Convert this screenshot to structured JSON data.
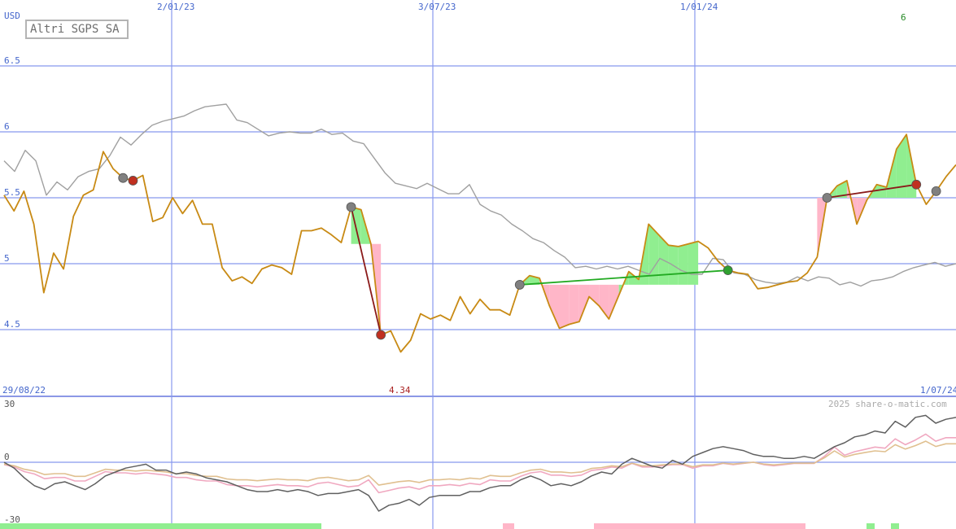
{
  "chart_data": [
    {
      "type": "line",
      "title": "Altri SGPS SA",
      "ylabel": "USD",
      "ylim": [
        4.0,
        7.0
      ],
      "yticks": [
        4.5,
        5,
        5.5,
        6,
        6.5
      ],
      "ytick_labels": [
        "4.5",
        "5",
        "5.5",
        "6",
        "6.5"
      ],
      "top_date_labels": [
        "2/01/23",
        "3/07/23",
        "1/01/24"
      ],
      "start_date": "29/08/22",
      "end_date": "1/07/24",
      "low_label": "4.34",
      "high_label": "6",
      "series": [
        {
          "values": [
            5.52,
            5.4,
            5.55,
            5.3,
            4.78,
            5.08,
            4.96,
            5.36,
            5.52,
            5.56,
            5.85,
            5.72,
            5.65,
            5.63,
            5.67,
            5.32,
            5.35,
            5.5,
            5.38,
            5.48,
            5.3,
            5.3,
            4.97,
            4.87,
            4.9,
            4.85,
            4.96,
            4.99,
            4.97,
            4.92,
            5.25,
            5.25,
            5.27,
            5.22,
            5.16,
            5.43,
            5.41,
            5.15,
            4.46,
            4.49,
            4.33,
            4.42,
            4.62,
            4.58,
            4.61,
            4.57,
            4.75,
            4.62,
            4.73,
            4.65,
            4.65,
            4.61,
            4.84,
            4.91,
            4.89,
            4.68,
            4.51,
            4.54,
            4.56,
            4.75,
            4.68,
            4.58,
            4.76,
            4.94,
            4.88,
            5.3,
            5.22,
            5.14,
            5.13,
            5.15,
            5.17,
            5.12,
            5.02,
            4.95,
            4.93,
            4.92,
            4.81,
            4.82,
            4.84,
            4.86,
            4.87,
            4.93,
            5.05,
            5.5,
            5.59,
            5.63,
            5.3,
            5.48,
            5.6,
            5.58,
            5.87,
            5.98,
            5.6,
            5.45,
            5.55,
            5.66,
            5.75
          ]
        },
        {
          "values": [
            5.78,
            5.7,
            5.86,
            5.78,
            5.52,
            5.62,
            5.56,
            5.66,
            5.7,
            5.72,
            5.82,
            5.96,
            5.9,
            5.98,
            6.05,
            6.08,
            6.1,
            6.12,
            6.16,
            6.19,
            6.2,
            6.21,
            6.09,
            6.07,
            6.02,
            5.97,
            5.99,
            6.0,
            5.99,
            5.99,
            6.02,
            5.98,
            5.99,
            5.93,
            5.91,
            5.8,
            5.69,
            5.61,
            5.59,
            5.57,
            5.61,
            5.57,
            5.53,
            5.53,
            5.6,
            5.45,
            5.4,
            5.37,
            5.3,
            5.25,
            5.19,
            5.16,
            5.1,
            5.05,
            4.97,
            4.98,
            4.96,
            4.98,
            4.96,
            4.98,
            4.95,
            4.92,
            5.04,
            5.0,
            4.95,
            4.92,
            4.92,
            5.04,
            5.03,
            4.93,
            4.92,
            4.88,
            4.86,
            4.85,
            4.86,
            4.9,
            4.87,
            4.9,
            4.89,
            4.84,
            4.86,
            4.83,
            4.87,
            4.88,
            4.9,
            4.94,
            4.97,
            4.99,
            5.01,
            4.98,
            5.0
          ]
        }
      ]
    },
    {
      "type": "line",
      "ylim": [
        -30,
        30
      ],
      "yticks": [
        30,
        0,
        -30
      ],
      "ytick_labels": [
        "30",
        "0",
        "-30"
      ],
      "copyright": "2025 share-o-matic.com",
      "series": [
        {
          "values": [
            0,
            -3,
            -8,
            -12,
            -14,
            -11,
            -10,
            -12,
            -14,
            -11,
            -7,
            -5,
            -3,
            -2,
            -1,
            -4,
            -4,
            -6,
            -5,
            -6,
            -8,
            -9,
            -10,
            -12,
            -14,
            -15,
            -15,
            -14,
            -15,
            -14,
            -15,
            -17,
            -16,
            -16,
            -15,
            -14,
            -17,
            -25,
            -22,
            -21,
            -19,
            -22,
            -18,
            -17,
            -17,
            -17,
            -15,
            -15,
            -13,
            -12,
            -12,
            -9,
            -7,
            -9,
            -12,
            -11,
            -12,
            -10,
            -7,
            -5,
            -6,
            -1,
            2,
            0,
            -2,
            -3,
            1,
            -1,
            3,
            5,
            7,
            8,
            7,
            6,
            4,
            3,
            3,
            2,
            2,
            3,
            2,
            5,
            8,
            10,
            13,
            14,
            16,
            15,
            21,
            18,
            23,
            24,
            20,
            22,
            23
          ]
        },
        {
          "values": [
            -2,
            -4,
            -8,
            -10,
            -14,
            -13,
            -13,
            -16,
            -16,
            -12,
            -8,
            -9,
            -9,
            -10,
            -9,
            -10,
            -11,
            -13,
            -13,
            -15,
            -16,
            -16,
            -19,
            -20,
            -20,
            -21,
            -20,
            -19,
            -20,
            -20,
            -21,
            -18,
            -17,
            -19,
            -21,
            -20,
            -15,
            -26,
            -24,
            -22,
            -21,
            -23,
            -20,
            -20,
            -19,
            -20,
            -18,
            -19,
            -15,
            -16,
            -16,
            -12,
            -9,
            -8,
            -11,
            -11,
            -12,
            -11,
            -7,
            -6,
            -4,
            -5,
            -1,
            -4,
            -4,
            -3,
            -2,
            -2,
            -5,
            -3,
            -3,
            -1,
            -2,
            -1,
            0,
            -2,
            -3,
            -2,
            -1,
            -1,
            -1,
            5,
            13,
            6,
            9,
            11,
            13,
            12,
            20,
            15,
            19,
            24,
            18,
            21,
            21
          ]
        }
      ]
    }
  ]
}
